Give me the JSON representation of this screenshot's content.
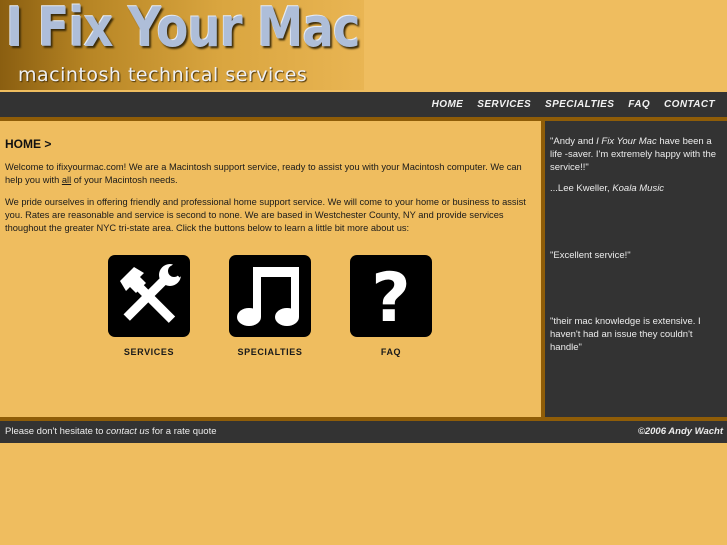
{
  "header": {
    "logo_title": "I Fix Your Mac",
    "logo_subtitle": "macintosh technical services"
  },
  "nav": {
    "items": [
      {
        "label": "HOME"
      },
      {
        "label": "SERVICES"
      },
      {
        "label": "SPECIALTIES"
      },
      {
        "label": "FAQ"
      },
      {
        "label": "CONTACT"
      }
    ]
  },
  "main": {
    "heading": "HOME >",
    "p1_before": "Welcome to ifixyourmac.com! We are a Macintosh support service, ready to assist you with your Macintosh computer. We can help you with ",
    "p1_underlined": "all",
    "p1_after": " of your Macintosh needs.",
    "p2": "We pride ourselves in offering friendly and professional home support service. We will come to your home or business to assist you. Rates are reasonable and service is second to none. We are based in Westchester County, NY and provide services thoughout the greater NYC tri-state area. Click the buttons below to learn a little bit more about us:",
    "icon_buttons": [
      {
        "label": "SERVICES",
        "icon": "tools-icon"
      },
      {
        "label": "SPECIALTIES",
        "icon": "music-note-icon"
      },
      {
        "label": "FAQ",
        "icon": "question-mark-icon"
      }
    ]
  },
  "sidebar": {
    "q1_before": "\"Andy and ",
    "q1_italic": "I Fix Your Mac",
    "q1_after": " have been a life -saver. I'm extremely happy with the service!!\"",
    "q1_author": "...Lee Kweller, ",
    "q1_company": "Koala Music",
    "q2": "\"Excellent service!\"",
    "q3": "\"their mac knowledge is extensive. I haven't had an issue they couldn't handle\""
  },
  "footer": {
    "left_before": "Please don't hesitate to ",
    "left_link": "contact us",
    "left_after": " for a rate quote",
    "copyright": "©2006 Andy Wacht"
  },
  "colors": {
    "background": "#efbd5f",
    "dark_bar": "#333333",
    "border_brown": "#8f5d08"
  }
}
